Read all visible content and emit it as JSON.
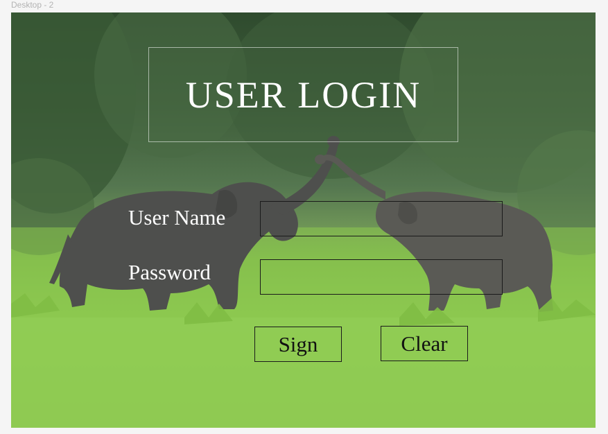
{
  "frame": {
    "label": "Desktop - 2"
  },
  "login": {
    "title": "USER LOGIN",
    "username_label": "User Name",
    "password_label": "Password",
    "username_value": "",
    "password_value": "",
    "sign_label": "Sign",
    "clear_label": "Clear"
  },
  "background": {
    "subject": "two-elephants-in-grass-field-photo"
  }
}
